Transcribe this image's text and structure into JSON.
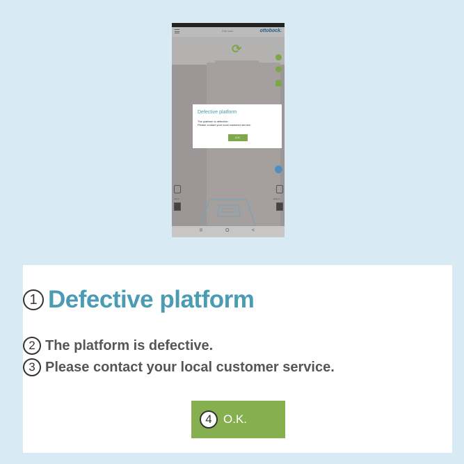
{
  "phone": {
    "app_title": "Edit data",
    "brand": "ottobock.",
    "dialog": {
      "title": "Defective platform",
      "line1": "The platform is defective.",
      "line2": "Please contact your local customer service.",
      "ok_label": "O.K."
    },
    "left_label": "LEFT",
    "right_label": "RIGHT",
    "nav": {
      "recent": "II",
      "home": "O",
      "back": "<"
    },
    "colors": {
      "accent_green": "#7fa84a",
      "title_blue": "#3e9bb5"
    }
  },
  "callout": {
    "title": {
      "num": "1",
      "text": "Defective platform"
    },
    "line1": {
      "num": "2",
      "text": "The platform is defective."
    },
    "line2": {
      "num": "3",
      "text": "Please contact your local customer service."
    },
    "ok": {
      "num": "4",
      "label": "O.K."
    },
    "colors": {
      "title": "#4a9bb3",
      "button": "#86b04f",
      "text": "#555555"
    }
  }
}
